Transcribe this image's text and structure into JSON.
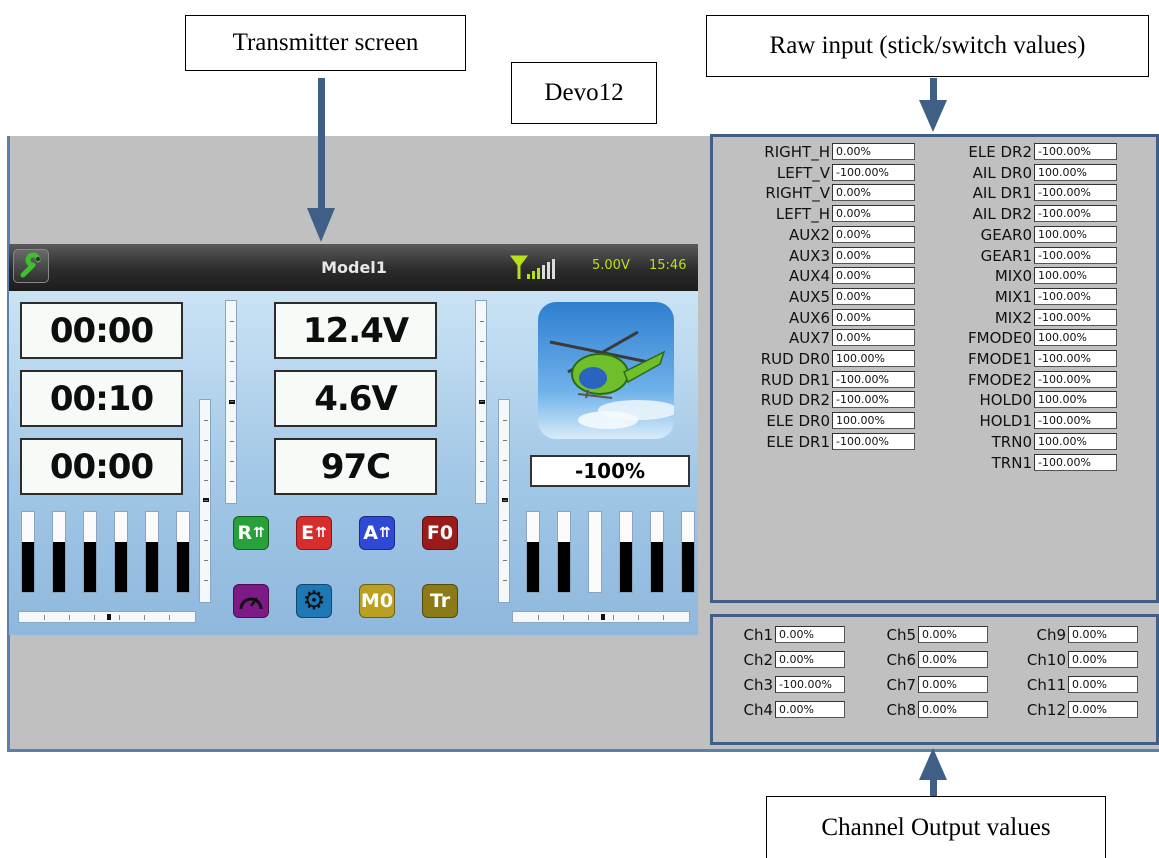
{
  "callouts": {
    "transmitter_screen": "Transmitter screen",
    "device": "Devo12",
    "raw_input": "Raw input (stick/switch values)",
    "channel_output": "Channel Output values"
  },
  "colors": {
    "accent_blue": "#3f5f86",
    "status_green": "#b8e01c"
  },
  "tx": {
    "model_name": "Model1",
    "battery": "5.00V",
    "time": "15:46",
    "timers": [
      "00:00",
      "00:10",
      "00:00"
    ],
    "telemetry": [
      "12.4V",
      "4.6V",
      "97C"
    ],
    "throttle": "-100%",
    "toggle_icons": [
      {
        "label": "R",
        "icon": "rudder-dr-icon",
        "color": "#27a13a"
      },
      {
        "label": "E",
        "icon": "elevator-dr-icon",
        "color": "#d92c2c"
      },
      {
        "label": "A",
        "icon": "aileron-dr-icon",
        "color": "#2d49d6"
      },
      {
        "label": "F0",
        "icon": "flight-mode-icon",
        "color": "#9b1b1b"
      },
      {
        "label": "",
        "icon": "gauge-icon",
        "color": "#7d1a86"
      },
      {
        "label": "",
        "icon": "gear-icon",
        "color": "#1f78b6"
      },
      {
        "label": "M0",
        "icon": "mix-icon",
        "color": "#b9a020"
      },
      {
        "label": "Tr",
        "icon": "trainer-icon",
        "color": "#8c7a17"
      }
    ],
    "left_sticks": [
      0.62,
      0.62,
      0.62,
      0.62,
      0.62,
      0.62
    ],
    "right_sticks": [
      0.62,
      0.62,
      0.0,
      0.62,
      0.62,
      0.62
    ]
  },
  "raw_inputs": {
    "left": [
      {
        "label": "RIGHT_H",
        "value": "0.00%"
      },
      {
        "label": "LEFT_V",
        "value": "-100.00%"
      },
      {
        "label": "RIGHT_V",
        "value": "0.00%"
      },
      {
        "label": "LEFT_H",
        "value": "0.00%"
      },
      {
        "label": "AUX2",
        "value": "0.00%"
      },
      {
        "label": "AUX3",
        "value": "0.00%"
      },
      {
        "label": "AUX4",
        "value": "0.00%"
      },
      {
        "label": "AUX5",
        "value": "0.00%"
      },
      {
        "label": "AUX6",
        "value": "0.00%"
      },
      {
        "label": "AUX7",
        "value": "0.00%"
      },
      {
        "label": "RUD DR0",
        "value": "100.00%"
      },
      {
        "label": "RUD DR1",
        "value": "-100.00%"
      },
      {
        "label": "RUD DR2",
        "value": "-100.00%"
      },
      {
        "label": "ELE DR0",
        "value": "100.00%"
      },
      {
        "label": "ELE DR1",
        "value": "-100.00%"
      }
    ],
    "right": [
      {
        "label": "ELE DR2",
        "value": "-100.00%"
      },
      {
        "label": "AIL DR0",
        "value": "100.00%"
      },
      {
        "label": "AIL DR1",
        "value": "-100.00%"
      },
      {
        "label": "AIL DR2",
        "value": "-100.00%"
      },
      {
        "label": "GEAR0",
        "value": "100.00%"
      },
      {
        "label": "GEAR1",
        "value": "-100.00%"
      },
      {
        "label": "MIX0",
        "value": "100.00%"
      },
      {
        "label": "MIX1",
        "value": "-100.00%"
      },
      {
        "label": "MIX2",
        "value": "-100.00%"
      },
      {
        "label": "FMODE0",
        "value": "100.00%"
      },
      {
        "label": "FMODE1",
        "value": "-100.00%"
      },
      {
        "label": "FMODE2",
        "value": "-100.00%"
      },
      {
        "label": "HOLD0",
        "value": "100.00%"
      },
      {
        "label": "HOLD1",
        "value": "-100.00%"
      },
      {
        "label": "TRN0",
        "value": "100.00%"
      },
      {
        "label": "TRN1",
        "value": "-100.00%"
      }
    ]
  },
  "channels": [
    [
      {
        "label": "Ch1",
        "value": "0.00%"
      },
      {
        "label": "Ch5",
        "value": "0.00%"
      },
      {
        "label": "Ch9",
        "value": "0.00%"
      }
    ],
    [
      {
        "label": "Ch2",
        "value": "0.00%"
      },
      {
        "label": "Ch6",
        "value": "0.00%"
      },
      {
        "label": "Ch10",
        "value": "0.00%"
      }
    ],
    [
      {
        "label": "Ch3",
        "value": "-100.00%"
      },
      {
        "label": "Ch7",
        "value": "0.00%"
      },
      {
        "label": "Ch11",
        "value": "0.00%"
      }
    ],
    [
      {
        "label": "Ch4",
        "value": "0.00%"
      },
      {
        "label": "Ch8",
        "value": "0.00%"
      },
      {
        "label": "Ch12",
        "value": "0.00%"
      }
    ]
  ]
}
